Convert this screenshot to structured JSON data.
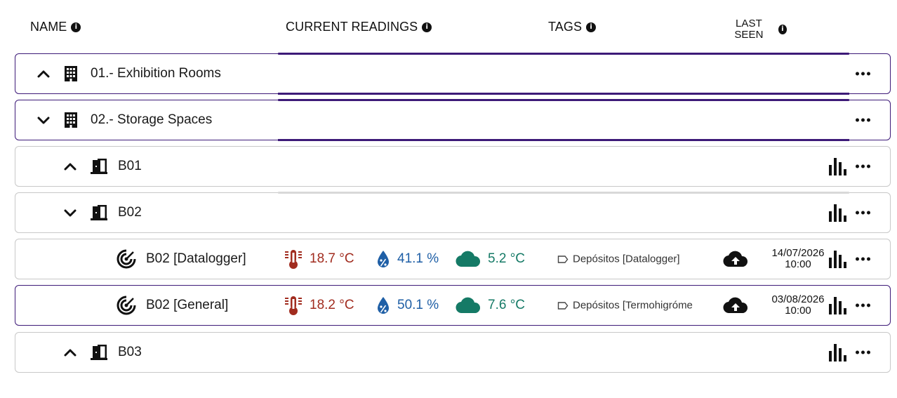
{
  "header": {
    "name": "NAME",
    "current_readings": "CURRENT READINGS",
    "tags": "TAGS",
    "last_seen": "LAST SEEN",
    "info_icon": "info-icon"
  },
  "rows": [
    {
      "label": "01.- Exhibition Rooms",
      "level": 0,
      "icon": "building-icon",
      "chevron": "chevron-up-icon"
    },
    {
      "label": "02.- Storage Spaces",
      "level": 0,
      "icon": "building-icon",
      "chevron": "chevron-down-icon"
    },
    {
      "label": "B01",
      "level": 1,
      "icon": "door-icon",
      "chevron": "chevron-up-icon"
    },
    {
      "label": "B02",
      "level": 1,
      "icon": "door-icon",
      "chevron": "chevron-down-icon"
    },
    {
      "label": "B02 [Datalogger]",
      "level": 2,
      "icon": "sensor-icon",
      "temperature": "18.7 °C",
      "humidity": "41.1 %",
      "dew_point": "5.2 °C",
      "tag": "Depósitos [Datalogger]",
      "last_seen_date": "14/07/2026",
      "last_seen_time": "10:00"
    },
    {
      "label": "B02 [General]",
      "level": 2,
      "icon": "sensor-icon",
      "temperature": "18.2 °C",
      "humidity": "50.1 %",
      "dew_point": "7.6 °C",
      "tag": "Depósitos [Termohigróme",
      "last_seen_date": "03/08/2026",
      "last_seen_time": "10:00"
    },
    {
      "label": "B03",
      "level": 1,
      "icon": "door-icon",
      "chevron": "chevron-up-icon"
    }
  ],
  "colors": {
    "accent": "#3d1a78",
    "temperature": "#a12c1f",
    "humidity": "#1f5fa6",
    "dew_point": "#157a66",
    "border": "#c8c8c8"
  }
}
